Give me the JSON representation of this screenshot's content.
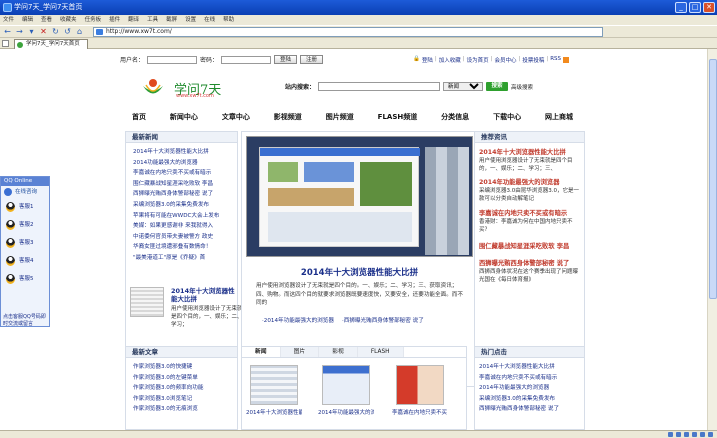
{
  "window": {
    "title": "学问7天_学问7天首页"
  },
  "menu": [
    "文件",
    "编辑",
    "查看",
    "收藏夹",
    "任务板",
    "插件",
    "翻译",
    "工具",
    "截屏",
    "设置",
    "在线",
    "帮助"
  ],
  "toolbar": {
    "url": "http://www.xw7t.com/"
  },
  "tab": {
    "label": "学问7天_学问7天首页"
  },
  "login": {
    "user_label": "用户名：",
    "pass_label": "密码：",
    "login_btn": "登陆",
    "register_btn": "注册"
  },
  "toplinks": [
    "登陆",
    "加入收藏",
    "设为首页",
    "会员中心",
    "投票投稿",
    "RSS"
  ],
  "logo": {
    "name": "学问7天",
    "url": "www.xw7t.com"
  },
  "search": {
    "label": "站内搜索：",
    "select": "新闻",
    "go": "搜索",
    "advanced": "高级搜索"
  },
  "nav": [
    "首页",
    "新闻中心",
    "文章中心",
    "影视频道",
    "图片频道",
    "FLASH频道",
    "分类信息",
    "下载中心",
    "网上商城"
  ],
  "latest": {
    "title": "最新新闻",
    "items": [
      "2014年十大浏览器性能大比拼",
      "2014功能最强大的浏览器",
      "李嘉诚在内地只卖不买或有暗示",
      "围仁藏暴战知星涯采吃败软 李昌",
      "西狮曝光贿西身体警部秘密 说了",
      "采编浏览器3.0的采集免费发布",
      "苹果将有可能在WWDC大会上发布",
      "美媒：如果更感谢非 来我就得入",
      "中诺委何官员带夫妻被警方 政史",
      "华裔女匪过境遭邪叠有数情命！",
      "\"最美港道工\"原是《乔疑》首"
    ],
    "feature_title": "2014年十大浏览器性能大比拼",
    "feature_desc": "用户使用浏览器设计了无束就是四个目的，一、娱乐；二、学习；"
  },
  "center": {
    "headline": "2014年十大浏览器性能大比拼",
    "desc": "用户使用浏览器设计了无束就是四个目的。一、娱乐；二、学习；三、获取资讯；四、购物。而这四个目的就要求浏览器既要速度快，又要安全，还要功能全面。而不同的",
    "rel": [
      "·2014年功能最强大的浏览器",
      "·西狮曝光贿西身体警部秘密 说了"
    ]
  },
  "recommend": {
    "title": "推荐资讯",
    "items": [
      {
        "head": "2014年十大浏览器性能大比拼",
        "text": "用户使用浏览器设计了无束就是四个目的，一、娱乐；二、学习；三、"
      },
      {
        "head": "2014年功能最强大的浏览器",
        "text": "采编浏览器3.0由昆华浏览器3.0，它是一款可以分类自动解笔记"
      },
      {
        "head": "李嘉诚在内地只卖不买或有暗示",
        "text": "香港财：李嘉诚为何在中国内地只卖不买？"
      },
      {
        "head": "围仁藏暴战知星涯采吃败软 李昌",
        "text": ""
      },
      {
        "head": "西狮曝光贿西身体警部秘密 说了",
        "text": "西狮西身体状况在这个赛季出现了问题曝光国在《每日体育报》"
      }
    ]
  },
  "qq": {
    "top": "QQ Online",
    "online": "在线咨询",
    "items": [
      "客服1",
      "客服2",
      "客服3",
      "客服4",
      "客服5"
    ],
    "foot": "点击客服QQ号码即时交流或留言"
  },
  "bottom": {
    "articles_title": "最新文章",
    "articles": [
      "作家浏览器3.0的快捷键",
      "作家浏览器3.0的左键菜单",
      "作家浏览器3.0的频率向功能",
      "作家浏览器3.0浏览笔记",
      "作家浏览器3.0的无痕浏览"
    ],
    "tabs": [
      "新闻",
      "图片",
      "影视",
      "FLASH"
    ],
    "pics": [
      "2014年十大浏览器性能",
      "2014年功能最强大的浏",
      "李嘉诚在内地只卖不买"
    ],
    "hot_title": "热门点击",
    "hot": [
      "2014年十大浏览器性能大比拼",
      "李嘉诚在内地只卖不买或有暗示",
      "2014年功能最强大的浏览器",
      "采编浏览器3.0的采集免费发布",
      "西狮曝光贿西身体警部秘密 说了"
    ]
  }
}
